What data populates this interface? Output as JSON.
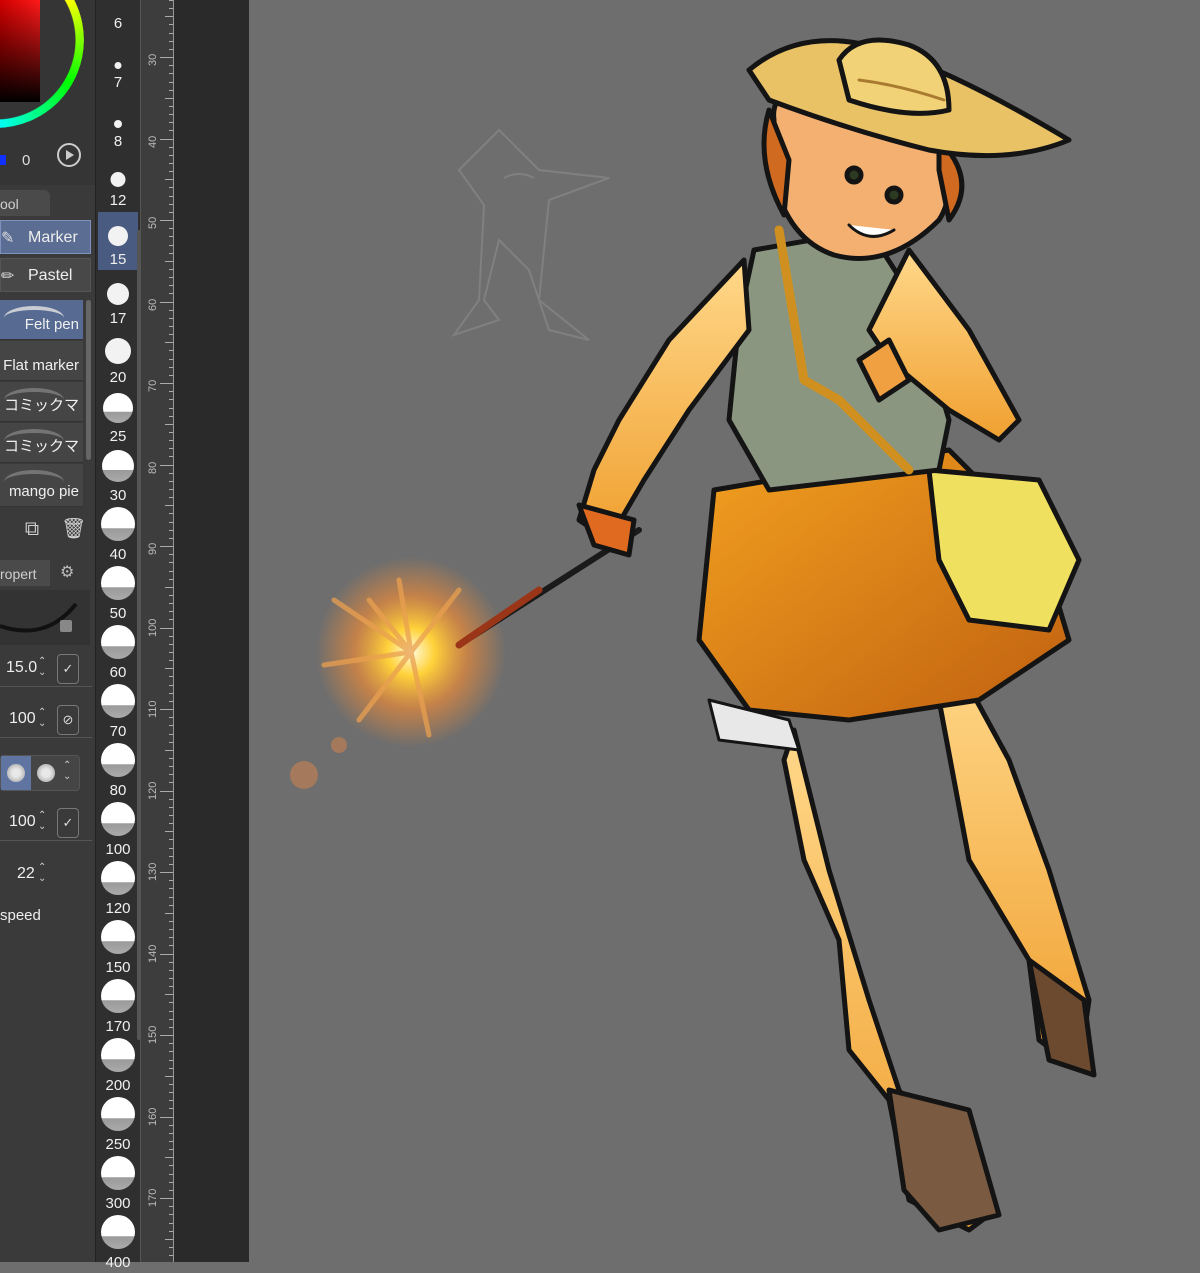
{
  "color_panel": {
    "hue_value": "0"
  },
  "tool_tab": {
    "label": "ool"
  },
  "sub_tools": [
    {
      "label": "Marker",
      "active": true,
      "icon": "marker-icon"
    },
    {
      "label": "Pastel",
      "active": false,
      "icon": "pastel-icon"
    }
  ],
  "brushes": [
    {
      "label": "Felt pen",
      "active": true
    },
    {
      "label": "Flat marker",
      "active": false
    },
    {
      "label": "コミックマ",
      "active": false
    },
    {
      "label": "コミックマ",
      "active": false
    },
    {
      "label": "mango pie",
      "active": false
    }
  ],
  "brush_actions": {
    "duplicate_icon": "duplicate-icon",
    "delete_icon": "trash-icon"
  },
  "property_tab": {
    "label": "ropert"
  },
  "properties": {
    "brush_size": "15.0",
    "opacity": "100",
    "density": "100",
    "stabilization": "22",
    "speed_label": "speed"
  },
  "brush_sizes": [
    "6",
    "7",
    "8",
    "12",
    "15",
    "17",
    "20",
    "25",
    "30",
    "40",
    "50",
    "60",
    "70",
    "80",
    "100",
    "120",
    "150",
    "170",
    "200",
    "250",
    "300",
    "400"
  ],
  "active_brush_size": "15",
  "ruler_labels": [
    "30",
    "40",
    "50",
    "60",
    "70",
    "80",
    "90",
    "100",
    "110",
    "120",
    "130",
    "140",
    "150",
    "160",
    "170"
  ],
  "colors": {
    "accent": "#5b6d93",
    "panel": "#3a3a3a",
    "canvas": "#6e6e6e"
  }
}
